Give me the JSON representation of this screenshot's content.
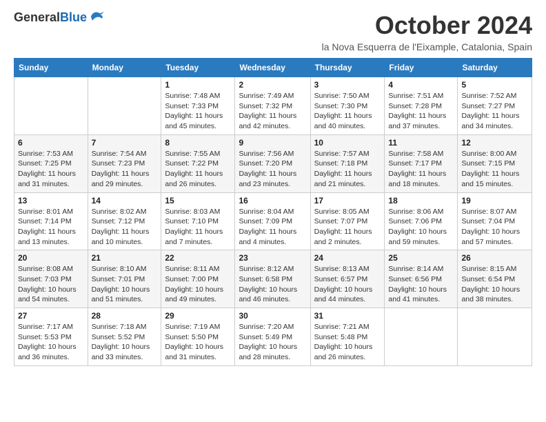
{
  "logo": {
    "general": "General",
    "blue": "Blue"
  },
  "title": "October 2024",
  "location": "la Nova Esquerra de l'Eixample, Catalonia, Spain",
  "weekdays": [
    "Sunday",
    "Monday",
    "Tuesday",
    "Wednesday",
    "Thursday",
    "Friday",
    "Saturday"
  ],
  "weeks": [
    [
      {
        "day": null,
        "detail": ""
      },
      {
        "day": null,
        "detail": ""
      },
      {
        "day": "1",
        "detail": "Sunrise: 7:48 AM\nSunset: 7:33 PM\nDaylight: 11 hours and 45 minutes."
      },
      {
        "day": "2",
        "detail": "Sunrise: 7:49 AM\nSunset: 7:32 PM\nDaylight: 11 hours and 42 minutes."
      },
      {
        "day": "3",
        "detail": "Sunrise: 7:50 AM\nSunset: 7:30 PM\nDaylight: 11 hours and 40 minutes."
      },
      {
        "day": "4",
        "detail": "Sunrise: 7:51 AM\nSunset: 7:28 PM\nDaylight: 11 hours and 37 minutes."
      },
      {
        "day": "5",
        "detail": "Sunrise: 7:52 AM\nSunset: 7:27 PM\nDaylight: 11 hours and 34 minutes."
      }
    ],
    [
      {
        "day": "6",
        "detail": "Sunrise: 7:53 AM\nSunset: 7:25 PM\nDaylight: 11 hours and 31 minutes."
      },
      {
        "day": "7",
        "detail": "Sunrise: 7:54 AM\nSunset: 7:23 PM\nDaylight: 11 hours and 29 minutes."
      },
      {
        "day": "8",
        "detail": "Sunrise: 7:55 AM\nSunset: 7:22 PM\nDaylight: 11 hours and 26 minutes."
      },
      {
        "day": "9",
        "detail": "Sunrise: 7:56 AM\nSunset: 7:20 PM\nDaylight: 11 hours and 23 minutes."
      },
      {
        "day": "10",
        "detail": "Sunrise: 7:57 AM\nSunset: 7:18 PM\nDaylight: 11 hours and 21 minutes."
      },
      {
        "day": "11",
        "detail": "Sunrise: 7:58 AM\nSunset: 7:17 PM\nDaylight: 11 hours and 18 minutes."
      },
      {
        "day": "12",
        "detail": "Sunrise: 8:00 AM\nSunset: 7:15 PM\nDaylight: 11 hours and 15 minutes."
      }
    ],
    [
      {
        "day": "13",
        "detail": "Sunrise: 8:01 AM\nSunset: 7:14 PM\nDaylight: 11 hours and 13 minutes."
      },
      {
        "day": "14",
        "detail": "Sunrise: 8:02 AM\nSunset: 7:12 PM\nDaylight: 11 hours and 10 minutes."
      },
      {
        "day": "15",
        "detail": "Sunrise: 8:03 AM\nSunset: 7:10 PM\nDaylight: 11 hours and 7 minutes."
      },
      {
        "day": "16",
        "detail": "Sunrise: 8:04 AM\nSunset: 7:09 PM\nDaylight: 11 hours and 4 minutes."
      },
      {
        "day": "17",
        "detail": "Sunrise: 8:05 AM\nSunset: 7:07 PM\nDaylight: 11 hours and 2 minutes."
      },
      {
        "day": "18",
        "detail": "Sunrise: 8:06 AM\nSunset: 7:06 PM\nDaylight: 10 hours and 59 minutes."
      },
      {
        "day": "19",
        "detail": "Sunrise: 8:07 AM\nSunset: 7:04 PM\nDaylight: 10 hours and 57 minutes."
      }
    ],
    [
      {
        "day": "20",
        "detail": "Sunrise: 8:08 AM\nSunset: 7:03 PM\nDaylight: 10 hours and 54 minutes."
      },
      {
        "day": "21",
        "detail": "Sunrise: 8:10 AM\nSunset: 7:01 PM\nDaylight: 10 hours and 51 minutes."
      },
      {
        "day": "22",
        "detail": "Sunrise: 8:11 AM\nSunset: 7:00 PM\nDaylight: 10 hours and 49 minutes."
      },
      {
        "day": "23",
        "detail": "Sunrise: 8:12 AM\nSunset: 6:58 PM\nDaylight: 10 hours and 46 minutes."
      },
      {
        "day": "24",
        "detail": "Sunrise: 8:13 AM\nSunset: 6:57 PM\nDaylight: 10 hours and 44 minutes."
      },
      {
        "day": "25",
        "detail": "Sunrise: 8:14 AM\nSunset: 6:56 PM\nDaylight: 10 hours and 41 minutes."
      },
      {
        "day": "26",
        "detail": "Sunrise: 8:15 AM\nSunset: 6:54 PM\nDaylight: 10 hours and 38 minutes."
      }
    ],
    [
      {
        "day": "27",
        "detail": "Sunrise: 7:17 AM\nSunset: 5:53 PM\nDaylight: 10 hours and 36 minutes."
      },
      {
        "day": "28",
        "detail": "Sunrise: 7:18 AM\nSunset: 5:52 PM\nDaylight: 10 hours and 33 minutes."
      },
      {
        "day": "29",
        "detail": "Sunrise: 7:19 AM\nSunset: 5:50 PM\nDaylight: 10 hours and 31 minutes."
      },
      {
        "day": "30",
        "detail": "Sunrise: 7:20 AM\nSunset: 5:49 PM\nDaylight: 10 hours and 28 minutes."
      },
      {
        "day": "31",
        "detail": "Sunrise: 7:21 AM\nSunset: 5:48 PM\nDaylight: 10 hours and 26 minutes."
      },
      {
        "day": null,
        "detail": ""
      },
      {
        "day": null,
        "detail": ""
      }
    ]
  ]
}
